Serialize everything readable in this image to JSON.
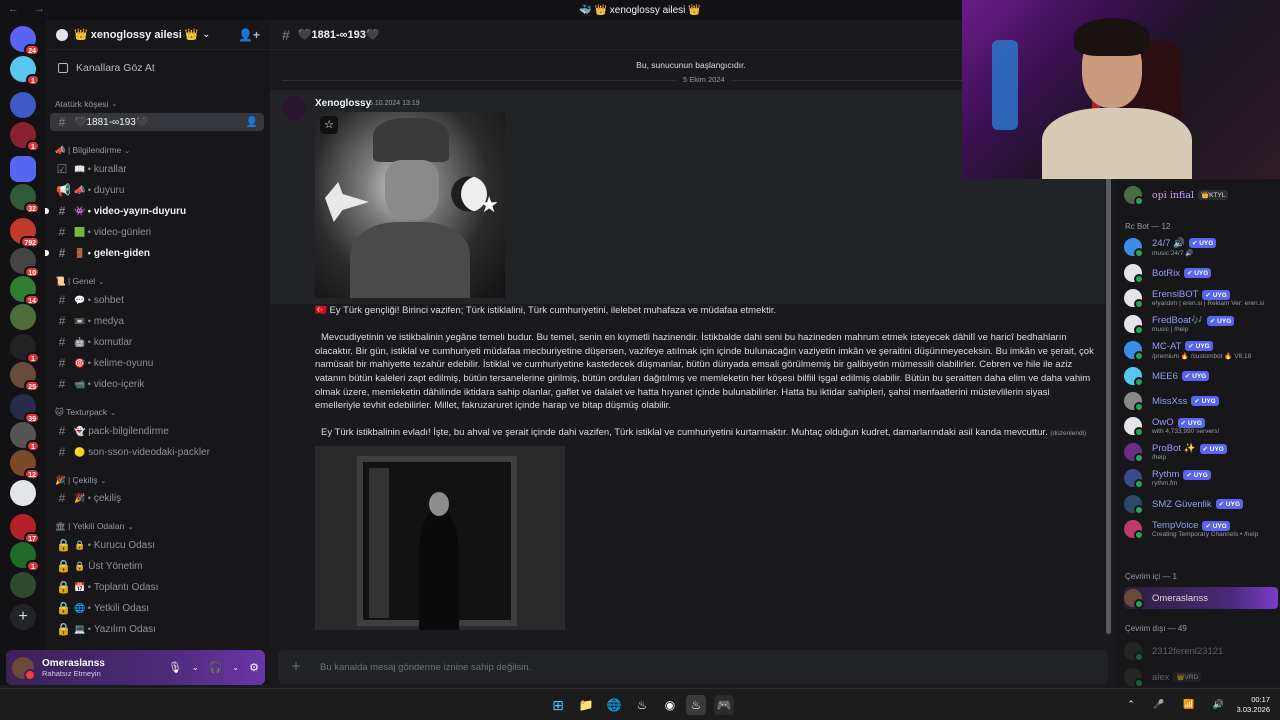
{
  "window": {
    "title": "🐳 👑 xenoglossy ailesi 👑",
    "nav": "← →"
  },
  "servers": {
    "items": [
      {
        "name": "home",
        "badge": "24",
        "color": "#5865f2"
      },
      {
        "name": "server-2",
        "badge": "1",
        "color": "#56c8f0"
      },
      {
        "name": "server-3",
        "badge": "",
        "color": "#3d5ac7"
      },
      {
        "name": "server-4",
        "badge": "1",
        "color": "#8a2130"
      },
      {
        "name": "folder",
        "badge": "",
        "color": "#5865f2"
      },
      {
        "name": "server-5",
        "badge": "32",
        "color": "#2f5a3a"
      },
      {
        "name": "server-6",
        "badge": "792",
        "color": "#c0392b"
      },
      {
        "name": "server-7",
        "badge": "10",
        "color": "#444"
      },
      {
        "name": "server-8",
        "badge": "14",
        "color": "#2e7d32"
      },
      {
        "name": "server-9",
        "badge": "",
        "color": "#4e6b3a"
      },
      {
        "name": "server-10",
        "badge": "1",
        "color": "#222"
      },
      {
        "name": "server-11",
        "badge": "25",
        "color": "#6a4a3a"
      },
      {
        "name": "server-12",
        "badge": "39",
        "color": "#2a2a4a"
      },
      {
        "name": "server-13",
        "badge": "1",
        "color": "#555"
      },
      {
        "name": "server-14",
        "badge": "12",
        "color": "#7a4a2a"
      },
      {
        "name": "server-15",
        "badge": "",
        "color": "#e3e5e8"
      },
      {
        "name": "server-16",
        "badge": "17",
        "color": "#b3202a"
      },
      {
        "name": "server-17",
        "badge": "1",
        "color": "#1e6b2a"
      },
      {
        "name": "server-18",
        "badge": "",
        "color": "#2f4a2f"
      }
    ],
    "add_label": "+"
  },
  "sidebar": {
    "guild_name": "👑 xenoglossy ailesi 👑",
    "browse_label": "Kanallara Göz At",
    "categories": [
      {
        "label": "Atatürk köşesi"
      },
      {
        "label": "📣 | Bilgilendirme"
      },
      {
        "label": "📜 | Genel"
      },
      {
        "label": "🐱 Texturpack"
      },
      {
        "label": "🎉 | Çekiliş"
      },
      {
        "label": "🏛 | Yetkili Odaları"
      }
    ],
    "channels": [
      {
        "label": "🖤1881-∞193🖤",
        "emo": ""
      },
      {
        "label": "kurallar",
        "emo": "📖 •"
      },
      {
        "label": "duyuru",
        "emo": "📣 •"
      },
      {
        "label": "video-yayın-duyuru",
        "emo": "👾 •"
      },
      {
        "label": "video-günleri",
        "emo": "🟩 •"
      },
      {
        "label": "gelen-giden",
        "emo": "🚪 •"
      },
      {
        "label": "sohbet",
        "emo": "💬 •"
      },
      {
        "label": "medya",
        "emo": "📼 •"
      },
      {
        "label": "komutlar",
        "emo": "🤖 •"
      },
      {
        "label": "kelime-oyunu",
        "emo": "🎯 •"
      },
      {
        "label": "video-içerik",
        "emo": "📹 •"
      },
      {
        "label": "pack-bilgilendirme",
        "emo": "👻"
      },
      {
        "label": "son-sson-videodaki-packler",
        "emo": "🟡"
      },
      {
        "label": "çekiliş",
        "emo": "🎉 •"
      },
      {
        "label": "Kurucu Odası",
        "emo": "🔒 •"
      },
      {
        "label": "Üst Yönetim",
        "emo": "🔒"
      },
      {
        "label": "Toplantı Odası",
        "emo": "📅 •"
      },
      {
        "label": "Yetkili Odası",
        "emo": "🌐 •"
      },
      {
        "label": "Yazılım Odası",
        "emo": "💻 •"
      }
    ]
  },
  "user": {
    "name": "Omeraslanss",
    "status": "Rahatsız Etmeyin"
  },
  "chat": {
    "channel_name": "🖤1881-∞193🖤",
    "begin_text": "Bu, sunucunun başlangıcıdır.",
    "date_divider": "5 Ekim 2024",
    "message": {
      "author": "Xenoglossy",
      "time": "5.10.2024 13:19",
      "p1": "🇹🇷 Ey Türk gençliği! Birinci vazifen; Türk istiklalini, Türk cumhuriyetini, ilelebet muhafaza ve müdafaa etmektir.",
      "p2": "Mevcudiyetinin ve istikbalinin yegâne temeli budur. Bu temel, senin en kıymetli hazinendir. İstikbalde dahi seni bu hazineden mahrum etmek isteyecek dâhilî ve haricî bedhahların olacaktır. Bir gün, istiklal ve cumhuriyeti müdafaa mecburiyetine düşersen, vazifeye atılmak için içinde bulunacağın vaziyetin imkân ve şeraitini düşünmeyeceksin. Bu imkân ve şerait, çok namüsait bir mahiyette tezahür edebilir. İstiklal ve cumhuriyetine kastedecek düşmanlar, bütün dünyada emsali görülmemiş bir galibiyetin mümessili olabilirler. Cebren ve hile ile aziz vatanın bütün kaleleri zapt edilmiş, bütün tersanelerine girilmiş, bütün orduları dağıtılmış ve memleketin her köşesi bilfiil işgal edilmiş olabilir. Bütün bu şeraitten daha elim ve daha vahim olmak üzere, memleketin dâhilinde iktidara sahip olanlar, gaflet ve dalalet ve hatta hıyanet içinde bulunabilirler. Hatta bu iktidar sahipleri, şahsi menfaatlerini müstevlilerin siyasi emelleriyle tevhit edebilirler. Millet, fakruzaruret içinde harap ve bitap düşmüş olabilir.",
      "p3": "Ey Türk istikbalinin evladı! İşte, bu ahval ve şerait içinde dahi vazifen, Türk istiklal ve cumhuriyetini kurtarmaktır. Muhtaç olduğun kudret, damarlarındaki asil kanda mevcuttur.",
      "edited": "(düzenlendi)"
    },
    "composer_placeholder": "Bu kanalda mesaj gönderme iznine sahip değilsin."
  },
  "members": {
    "top": {
      "name": "opi infial",
      "tag": "👑KTYL",
      "color": "#c9a0ff"
    },
    "bot_category": "Rc Bot — 12",
    "bots": [
      {
        "name": "24/7 🔊",
        "sub": "music 24/7 🔊",
        "color": "#5865f2",
        "av": "#3b8ee8"
      },
      {
        "name": "BotRix",
        "sub": "",
        "color": "#5865f2",
        "av": "#e3e5e8"
      },
      {
        "name": "ErensiBOT",
        "sub": "e!yardım | eren.si | Reklam Ver: eren.si",
        "color": "#5865f2",
        "av": "#e3e5e8"
      },
      {
        "name": "FredBoat🎶",
        "sub": "music | /help",
        "color": "#5865f2",
        "av": "#e3e5e8"
      },
      {
        "name": "MC-AT",
        "sub": "/premium 🔥 /custombot 🔥 V8.18",
        "color": "#5865f2",
        "av": "#3b8ee8"
      },
      {
        "name": "MEE6",
        "sub": "",
        "color": "#5865f2",
        "av": "#56c8f0"
      },
      {
        "name": "MissXss",
        "sub": "",
        "color": "#5865f2",
        "av": "#888"
      },
      {
        "name": "OwO",
        "sub": "with 4,733,990 servers!",
        "color": "#5865f2",
        "av": "#e3e5e8"
      },
      {
        "name": "ProBot ✨",
        "sub": "/help",
        "color": "#5865f2",
        "av": "#6a2e8a"
      },
      {
        "name": "Rythm",
        "sub": "rythm.fm",
        "color": "#5865f2",
        "av": "#3b4a8a"
      },
      {
        "name": "SMZ Güvenlik",
        "sub": "",
        "color": "#5865f2",
        "av": "#2a4a6a"
      },
      {
        "name": "TempVoice",
        "sub": "Creating Temporary Channels • /help",
        "color": "#5865f2",
        "av": "#c03a6a"
      }
    ],
    "bot_tag": "✔ UYG",
    "online_category": "Çevrim içi — 1",
    "online": [
      {
        "name": "Omeraslanss"
      }
    ],
    "offline_category": "Çevrim dışı — 49",
    "offline": [
      {
        "name": "2312ferenl23121"
      },
      {
        "name": "alex",
        "tag": "👑VRD"
      }
    ]
  },
  "taskbar": {
    "time": "00:17",
    "date": "3.03.2026",
    "tray": "⌃ 🎤 📶 🔊"
  }
}
